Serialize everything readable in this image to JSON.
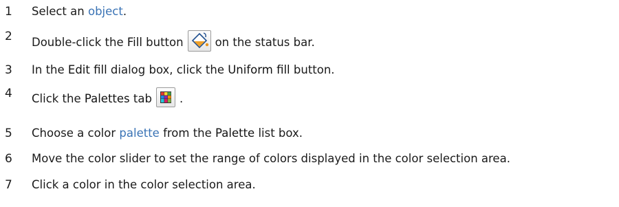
{
  "steps": [
    {
      "num": "1",
      "parts": {
        "a": "Select an ",
        "link": "object",
        "b": "."
      }
    },
    {
      "num": "2",
      "parts": {
        "a": "Double-click the ",
        "bold": "Fill",
        "b": " button",
        "c": "on the status bar."
      },
      "icon": "fill-bucket-icon"
    },
    {
      "num": "3",
      "parts": {
        "a": "In the ",
        "bold1": "Edit fill",
        "b": " dialog box, click the ",
        "bold2": "Uniform fill",
        "c": " button."
      }
    },
    {
      "num": "4",
      "parts": {
        "a": "Click the ",
        "bold": "Palettes",
        "b": " tab",
        "c": "."
      },
      "icon": "palette-grid-icon"
    },
    {
      "num": "5",
      "parts": {
        "a": "Choose a color ",
        "link": "palette",
        "b": " from the ",
        "bold": "Palette",
        "c": " list box."
      }
    },
    {
      "num": "6",
      "parts": {
        "a": "Move the color slider to set the range of colors displayed in the color selection area."
      }
    },
    {
      "num": "7",
      "parts": {
        "a": "Click a color in the color selection area."
      }
    }
  ],
  "colors": {
    "text": "#1a1a1a",
    "link": "#3a73b5"
  }
}
